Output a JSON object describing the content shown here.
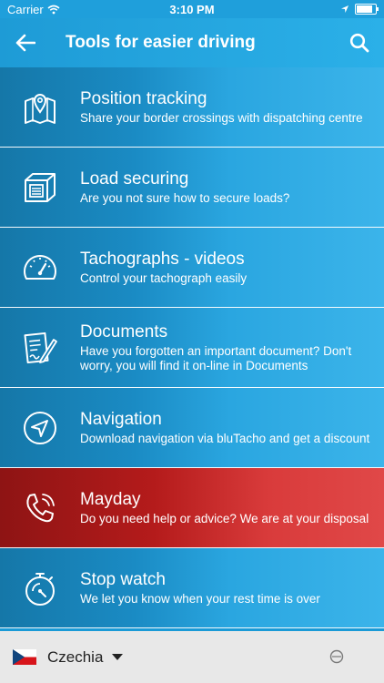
{
  "status_bar": {
    "carrier": "Carrier",
    "time": "3:10 PM",
    "battery_level": 0.95
  },
  "header": {
    "title": "Tools for easier driving",
    "back_icon": "arrow-left-icon",
    "search_icon": "search-icon"
  },
  "items": [
    {
      "title": "Position tracking",
      "subtitle": "Share your border crossings with dispatching centre",
      "icon": "map-pin-icon"
    },
    {
      "title": "Load securing",
      "subtitle": "Are you not sure how to secure loads?",
      "icon": "cargo-box-icon"
    },
    {
      "title": "Tachographs - videos",
      "subtitle": "Control your tachograph easily",
      "icon": "speedometer-icon"
    },
    {
      "title": "Documents",
      "subtitle": "Have you forgotten an important document? Don't worry, you will find it on-line in Documents",
      "icon": "document-icon"
    },
    {
      "title": "Navigation",
      "subtitle": "Download navigation via bluTacho and get a discount",
      "icon": "navigation-arrow-icon"
    },
    {
      "title": "Mayday",
      "subtitle": "Do you need help or advice? We are at your disposal",
      "icon": "phone-ringing-icon"
    },
    {
      "title": "Stop watch",
      "subtitle": "We let you know when your rest time is over",
      "icon": "stopwatch-icon"
    }
  ],
  "footer": {
    "country": "Czechia",
    "flag_icon": "czech-flag-icon",
    "dropdown_icon": "caret-down-icon",
    "logo": "brand-logo-icon"
  },
  "colors": {
    "primary": "#1e9bd6",
    "mayday": "#c62828",
    "footer_bg": "#e8e8e8"
  }
}
